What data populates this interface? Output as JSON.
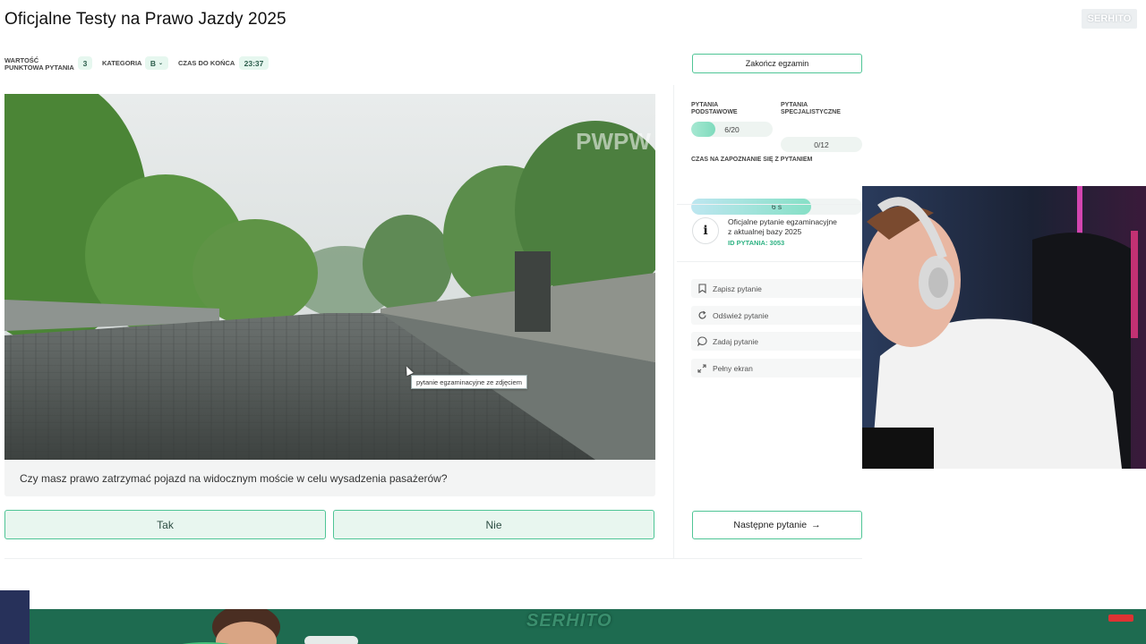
{
  "header": {
    "title": "Oficjalne Testy na Prawo Jazdy 2025",
    "logo": "SERHITO"
  },
  "stats": {
    "points_label_1": "WARTOŚĆ",
    "points_label_2": "PUNKTOWA PYTANIA",
    "points_value": "3",
    "category_label": "KATEGORIA",
    "category_value": "B",
    "time_label": "CZAS DO KOŃCA",
    "time_value": "23:37",
    "end_button": "Zakończ egzamin"
  },
  "question": {
    "image_watermark": "PWPW",
    "tooltip": "pytanie egzaminacyjne ze zdjęciem",
    "text": "Czy masz prawo zatrzymać pojazd na widocznym moście w celu wysadzenia pasażerów?",
    "answers": [
      "Tak",
      "Nie"
    ]
  },
  "panel": {
    "basic_label_1": "PYTANIA",
    "basic_label_2": "PODSTAWOWE",
    "basic_progress": "6/20",
    "basic_fraction": 0.3,
    "special_label_1": "PYTANIA",
    "special_label_2": "SPECJALISTYCZNE",
    "special_progress": "0/12",
    "special_fraction": 0,
    "reading_time_label": "CZAS NA ZAPOZNANIE SIĘ Z PYTANIEM",
    "reading_time_value": "6 s",
    "reading_time_fraction": 0.7,
    "info_line_1": "Oficjalne pytanie egzaminacyjne",
    "info_line_2": "z aktualnej bazy 2025",
    "info_id": "ID PYTANIA: 3053",
    "actions": [
      {
        "icon": "bookmark-icon",
        "label": "Zapisz pytanie"
      },
      {
        "icon": "refresh-icon",
        "label": "Odśwież pytanie"
      },
      {
        "icon": "chat-icon",
        "label": "Zadaj pytanie"
      },
      {
        "icon": "expand-icon",
        "label": "Pełny ekran"
      }
    ],
    "next_button": "Następne pytanie"
  },
  "banner": {
    "logo": "SERHITO"
  },
  "colors": {
    "accent": "#4fc596",
    "accent_light": "#e8f6ef",
    "banner": "#1e6b50"
  }
}
